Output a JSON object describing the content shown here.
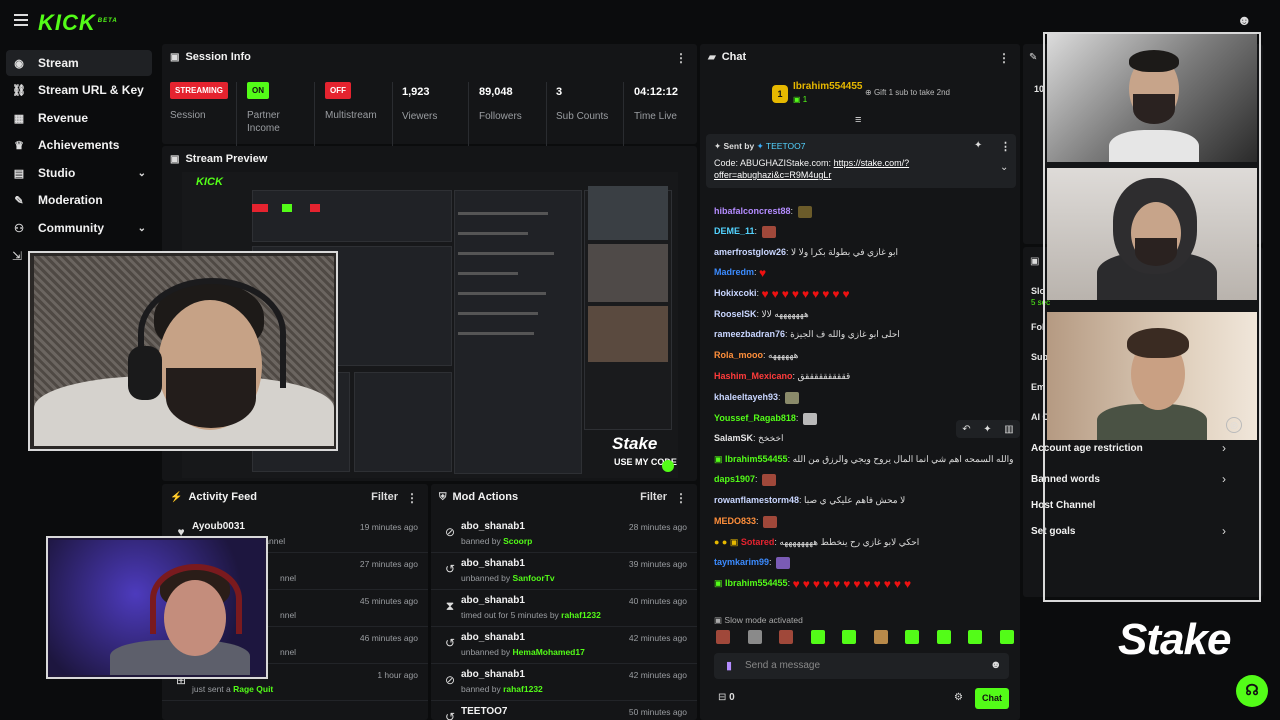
{
  "sidebar": {
    "logo": "KICK",
    "logo_sup": "BETA",
    "items": [
      {
        "label": "Stream",
        "icon": "broadcast-icon",
        "glyph": "◉"
      },
      {
        "label": "Stream URL & Key",
        "icon": "link-icon",
        "glyph": "⛓"
      },
      {
        "label": "Revenue",
        "icon": "chart-icon",
        "glyph": "▦"
      },
      {
        "label": "Achievements",
        "icon": "trophy-icon",
        "glyph": "♛"
      },
      {
        "label": "Studio",
        "icon": "studio-icon",
        "glyph": "▤"
      },
      {
        "label": "Moderation",
        "icon": "wrench-icon",
        "glyph": "✎"
      },
      {
        "label": "Community",
        "icon": "community-icon",
        "glyph": "⚇"
      }
    ]
  },
  "session": {
    "title": "Session Info",
    "stats": [
      {
        "badge": "STREAMING",
        "label": "Session",
        "color": "#e5232f"
      },
      {
        "badge": "ON",
        "label": "Partner Income",
        "color": "#53fc18"
      },
      {
        "badge": "OFF",
        "label": "Multistream",
        "color": "#e5232f"
      },
      {
        "value": "1,923",
        "label": "Viewers"
      },
      {
        "value": "89,048",
        "label": "Followers"
      },
      {
        "value": "3",
        "label": "Sub Counts"
      },
      {
        "value": "04:12:12",
        "label": "Time Live"
      }
    ]
  },
  "preview": {
    "title": "Stream Preview",
    "overlay_brand": "Stake",
    "overlay_code": "USE MY CODE"
  },
  "activity": {
    "title": "Activity Feed",
    "filter": "Filter",
    "rows": [
      {
        "name": "Ayoub0031",
        "sub": "just followed the channel",
        "time": "19 minutes ago"
      },
      {
        "name": "",
        "sub": "nnel",
        "time": "27 minutes ago"
      },
      {
        "name": "",
        "sub": "nnel",
        "time": "45 minutes ago"
      },
      {
        "name": "",
        "sub": "nnel",
        "time": "46 minutes ago"
      },
      {
        "name": "",
        "sub": "just sent a",
        "gift": "Rage Quit",
        "time": "1 hour ago"
      }
    ]
  },
  "mod": {
    "title": "Mod Actions",
    "filter": "Filter",
    "rows": [
      {
        "name": "abo_shanab1",
        "sub": "banned by",
        "by": "Scoorp",
        "time": "28 minutes ago",
        "icon": "ban-icon",
        "glyph": "⊘"
      },
      {
        "name": "abo_shanab1",
        "sub": "unbanned by",
        "by": "SanfoorTv",
        "time": "39 minutes ago",
        "icon": "undo-icon",
        "glyph": "↺"
      },
      {
        "name": "abo_shanab1",
        "sub": "timed out for 5 minutes by",
        "by": "rahaf1232",
        "time": "40 minutes ago",
        "icon": "hourglass-icon",
        "glyph": "⧗"
      },
      {
        "name": "abo_shanab1",
        "sub": "unbanned by",
        "by": "HemaMohamed17",
        "time": "42 minutes ago",
        "icon": "undo-icon",
        "glyph": "↺"
      },
      {
        "name": "abo_shanab1",
        "sub": "banned by",
        "by": "rahaf1232",
        "time": "42 minutes ago",
        "icon": "ban-icon",
        "glyph": "⊘"
      },
      {
        "name": "TEETOO7",
        "sub": "",
        "by": "",
        "time": "50 minutes ago",
        "icon": "undo-icon",
        "glyph": "↺"
      }
    ]
  },
  "chat": {
    "title": "Chat",
    "top_gifter": {
      "rank": "1",
      "name": "Ibrahim554455",
      "count": "1",
      "gift_note": "Gift 1 sub to take 2nd"
    },
    "pinned": {
      "sent_by_label": "Sent by",
      "sender": "TEETOO7",
      "text": "Code: ABUGHAZIStake.com:",
      "link": "https://stake.com/?offer=abughazi&c=R9M4ugLr"
    },
    "messages": [
      {
        "user": "hibafalconcrest88",
        "color": "#b48cff",
        "text": "",
        "emote": "#6b5b2a"
      },
      {
        "user": "DEME_11",
        "color": "#53d3ff",
        "text": "",
        "emote": "#a0483a"
      },
      {
        "user": "amerfrostglow26",
        "color": "#c9d6ff",
        "text": "ابو غازي في بطولة بكرا ولا لا"
      },
      {
        "user": "Madredm",
        "color": "#3b8bff",
        "text": "",
        "hearts": 1
      },
      {
        "user": "Hokixcoki",
        "color": "#c9d6ff",
        "text": "",
        "hearts": 9
      },
      {
        "user": "RooseISK",
        "color": "#c9d6ff",
        "text": "هههههههه لالا"
      },
      {
        "user": "rameezbadran76",
        "color": "#c9d6ff",
        "text": "احلى ابو غازي والله ف الجيزة"
      },
      {
        "user": "Rola_mooo",
        "color": "#ff8f3b",
        "text": "ههههههه"
      },
      {
        "user": "Hashim_Mexicano",
        "color": "#ff3b3b",
        "text": "ققققققققققق"
      },
      {
        "user": "khaleeltayeh93",
        "color": "#c9d6ff",
        "text": "",
        "emote": "#8a8a6a"
      },
      {
        "user": "Youssef_Ragab818",
        "color": "#53fc18",
        "text": "",
        "emote": "#b9b9b9"
      },
      {
        "user": "SalamSK",
        "color": "#e6e6e6",
        "text": "اخخخخ"
      },
      {
        "user": "Ibrahim554455",
        "color": "#53fc18",
        "text": "والله السمحه اهم شي انما المال يروح ويجي والرزق من الله"
      },
      {
        "user": "daps1907",
        "color": "#53fc18",
        "text": "",
        "emote": "#a0483a"
      },
      {
        "user": "rowanflamestorm48",
        "color": "#c9d6ff",
        "text": "لا محش فاهم عليكي ي صبا"
      },
      {
        "user": "MEDO833",
        "color": "#ff8f3b",
        "text": "",
        "emote": "#a0483a"
      },
      {
        "user": "Sotared",
        "color": "#e5232f",
        "text": "احكي لابو غازي رح ينخطط ههههههههه"
      },
      {
        "user": "taymkarim99",
        "color": "#3b8bff",
        "text": "",
        "emote": "#7a5bb5"
      },
      {
        "user": "Ibrahim554455",
        "color": "#53fc18",
        "text": "",
        "hearts": 12
      }
    ],
    "slow_mode": "Slow mode activated",
    "input_placeholder": "Send a message",
    "points": "0",
    "send_label": "Chat"
  },
  "right_panel": {
    "items": [
      {
        "label": "Account age restriction"
      },
      {
        "label": "Banned words"
      },
      {
        "label": "Host Channel"
      },
      {
        "label": "Set goals"
      }
    ],
    "fragments": [
      "Slo",
      "5 sec",
      "Fol",
      "Sub",
      "Em",
      "AI C",
      "10"
    ],
    "brand": "Stake"
  },
  "colors": {
    "accent": "#53fc18",
    "danger": "#e5232f",
    "panel": "#141517",
    "bg": "#0b0c0d"
  }
}
